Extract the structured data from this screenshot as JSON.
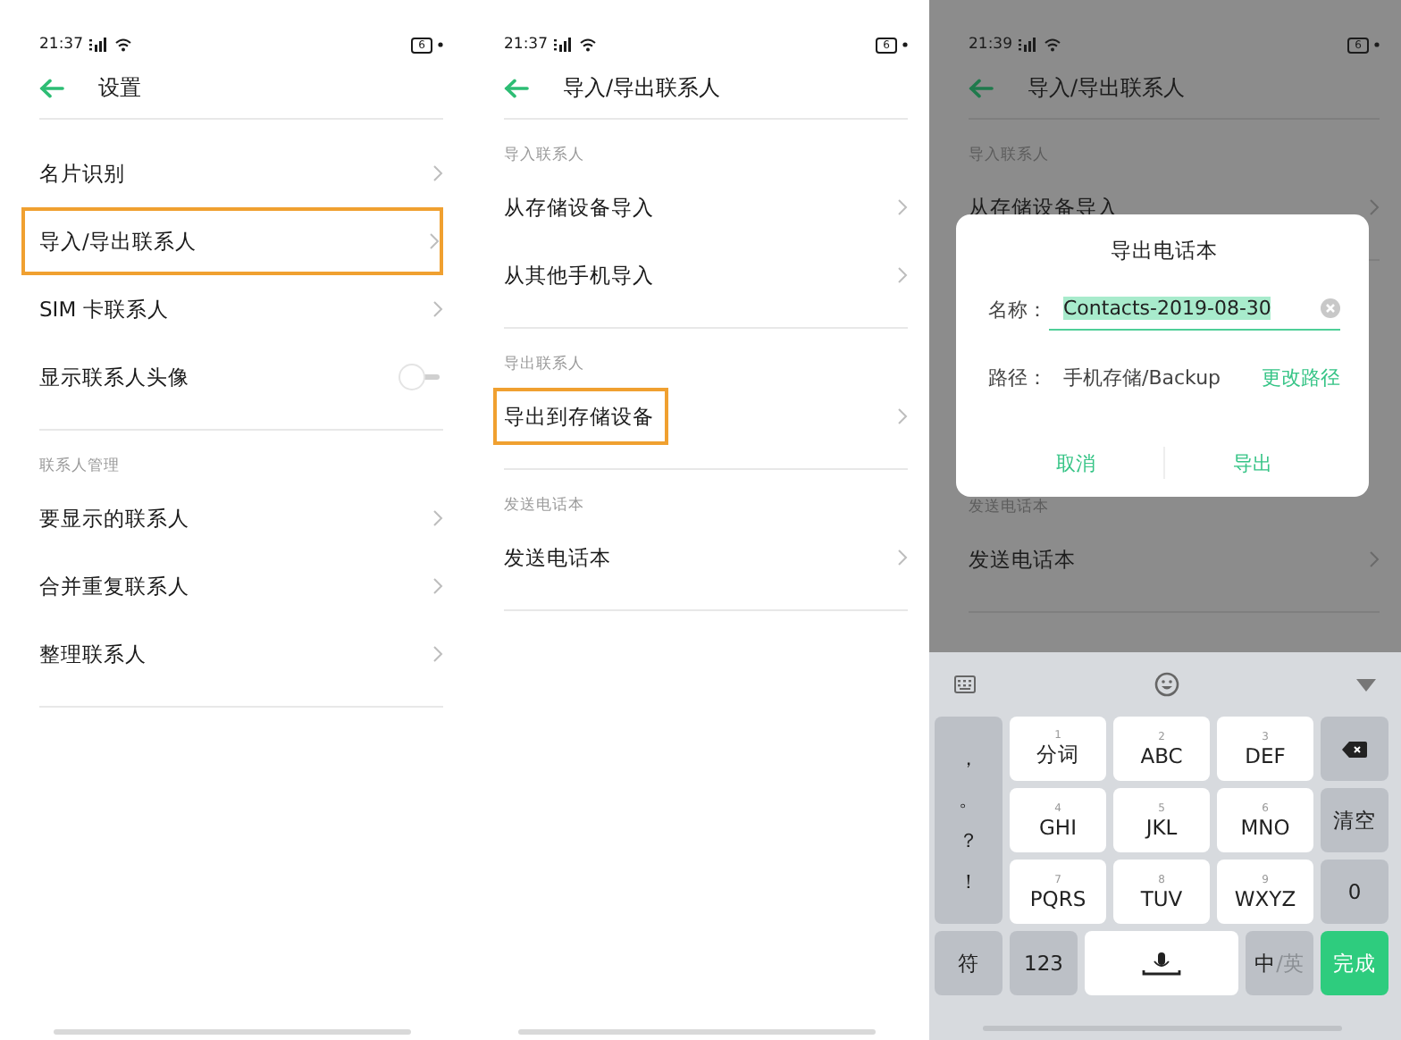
{
  "screens": [
    {
      "dimmed": false,
      "status_bar": {
        "time": "21:37",
        "battery": "6"
      },
      "header": {
        "title": "设置"
      },
      "groups": [
        {
          "items": [
            {
              "kind": "link",
              "label": "名片识别"
            },
            {
              "kind": "link",
              "label": "导入/导出联系人",
              "highlighted": true,
              "full_width": true
            },
            {
              "kind": "link",
              "label": "SIM 卡联系人"
            },
            {
              "kind": "switch",
              "label": "显示联系人头像",
              "on": false
            }
          ]
        },
        {
          "heading": "联系人管理",
          "items": [
            {
              "kind": "link",
              "label": "要显示的联系人"
            },
            {
              "kind": "link",
              "label": "合并重复联系人"
            },
            {
              "kind": "link",
              "label": "整理联系人"
            }
          ]
        }
      ]
    },
    {
      "dimmed": false,
      "status_bar": {
        "time": "21:37",
        "battery": "6"
      },
      "header": {
        "title": "导入/导出联系人"
      },
      "groups": [
        {
          "heading": "导入联系人",
          "items": [
            {
              "kind": "link",
              "label": "从存储设备导入"
            },
            {
              "kind": "link",
              "label": "从其他手机导入"
            }
          ]
        },
        {
          "heading": "导出联系人",
          "items": [
            {
              "kind": "link",
              "label": "导出到存储设备",
              "highlighted": true,
              "full_width": false
            }
          ]
        },
        {
          "heading": "发送电话本",
          "items": [
            {
              "kind": "link",
              "label": "发送电话本"
            }
          ]
        }
      ]
    },
    {
      "dimmed": true,
      "status_bar": {
        "time": "21:39",
        "battery": "6"
      },
      "header": {
        "title": "导入/导出联系人"
      },
      "groups": [
        {
          "heading": "导入联系人",
          "items": [
            {
              "kind": "link",
              "label": "从存储设备导入"
            }
          ]
        },
        {
          "heading": "发送电话本",
          "items": [
            {
              "kind": "link",
              "label": "发送电话本"
            }
          ]
        }
      ],
      "dialog": {
        "title": "导出电话本",
        "name_label": "名称：",
        "name_value": "Contacts-2019-08-30",
        "value_selected": true,
        "path_label": "路径：",
        "path_value": "手机存储/Backup",
        "path_link": "更改路径",
        "buttons": [
          "取消",
          "导出"
        ]
      },
      "keyboard": {
        "keys": [
          {
            "kind": "punct",
            "symbols": [
              "，",
              "。",
              "？",
              "！"
            ]
          },
          {
            "kind": "letter",
            "digit": "1",
            "label": "分词"
          },
          {
            "kind": "letter",
            "digit": "2",
            "label": "ABC"
          },
          {
            "kind": "letter",
            "digit": "3",
            "label": "DEF"
          },
          {
            "kind": "backspace"
          },
          {
            "kind": "letter",
            "digit": "4",
            "label": "GHI"
          },
          {
            "kind": "letter",
            "digit": "5",
            "label": "JKL"
          },
          {
            "kind": "letter",
            "digit": "6",
            "label": "MNO"
          },
          {
            "kind": "function",
            "label": "清空"
          },
          {
            "kind": "letter",
            "digit": "7",
            "label": "PQRS"
          },
          {
            "kind": "letter",
            "digit": "8",
            "label": "TUV"
          },
          {
            "kind": "letter",
            "digit": "9",
            "label": "WXYZ"
          },
          {
            "kind": "function",
            "label": "0"
          }
        ],
        "bottom_row": [
          {
            "kind": "function",
            "label": "符"
          },
          {
            "kind": "function",
            "label": "123"
          },
          {
            "kind": "space"
          },
          {
            "kind": "lang",
            "label": "中",
            "secondary": "/英"
          },
          {
            "kind": "action",
            "label": "完成"
          }
        ]
      }
    }
  ]
}
